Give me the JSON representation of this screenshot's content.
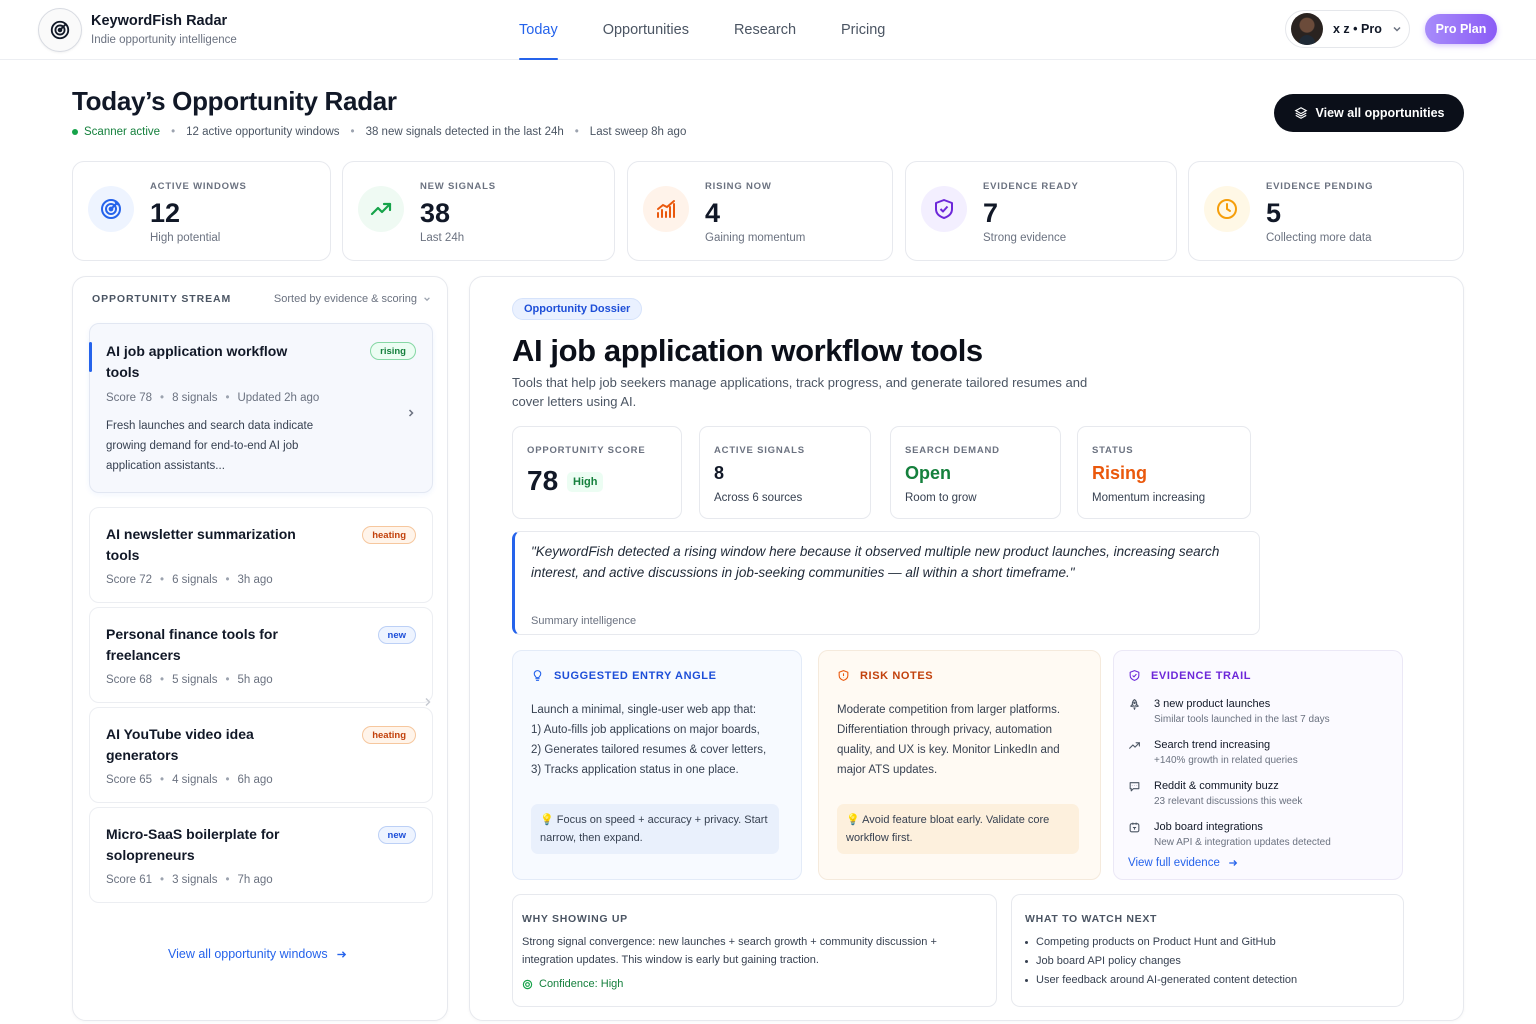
{
  "brand": {
    "name": "KeywordFish Radar",
    "tagline": "Indie opportunity intelligence"
  },
  "nav": {
    "items": [
      "Today",
      "Opportunities",
      "Research",
      "Pricing"
    ],
    "active": "Today"
  },
  "user": {
    "label": "x z • Pro",
    "plan_button": "Pro Plan"
  },
  "page": {
    "title": "Today’s Opportunity Radar",
    "scanner_status": "Scanner active",
    "windows_text": "12 active opportunity windows",
    "signals_text": "38 new signals detected in the last 24h",
    "sweep_text": "Last sweep 8h ago",
    "view_all_button": "View all opportunities"
  },
  "stats": [
    {
      "label": "ACTIVE WINDOWS",
      "value": "12",
      "sub": "High potential",
      "icon": "target-icon",
      "color": "#2563eb"
    },
    {
      "label": "NEW SIGNALS",
      "value": "38",
      "sub": "Last 24h",
      "icon": "trend-up-icon",
      "color": "#16a34a"
    },
    {
      "label": "RISING NOW",
      "value": "4",
      "sub": "Gaining momentum",
      "icon": "bar-chart-icon",
      "color": "#ea580c"
    },
    {
      "label": "EVIDENCE READY",
      "value": "7",
      "sub": "Strong evidence",
      "icon": "shield-check-icon",
      "color": "#6d28d9"
    },
    {
      "label": "EVIDENCE PENDING",
      "value": "5",
      "sub": "Collecting more data",
      "icon": "clock-icon",
      "color": "#f59e0b"
    }
  ],
  "stream": {
    "heading": "OPPORTUNITY STREAM",
    "sort_label": "Sorted by evidence & scoring",
    "footer_link": "View all opportunity windows",
    "items": [
      {
        "title": "AI job application workflow tools",
        "score": "Score 78",
        "signals": "8 signals",
        "time": "Updated 2h ago",
        "badge": "rising",
        "desc": "Fresh launches and search data indicate growing demand for end-to-end AI job application assistants..."
      },
      {
        "title": "AI newsletter summarization tools",
        "score": "Score 72",
        "signals": "6 signals",
        "time": "3h ago",
        "badge": "heating"
      },
      {
        "title": "Personal finance tools for freelancers",
        "score": "Score 68",
        "signals": "5 signals",
        "time": "5h ago",
        "badge": "new"
      },
      {
        "title": "AI YouTube video idea generators",
        "score": "Score 65",
        "signals": "4 signals",
        "time": "6h ago",
        "badge": "heating"
      },
      {
        "title": "Micro-SaaS boilerplate for solopreneurs",
        "score": "Score 61",
        "signals": "3 signals",
        "time": "7h ago",
        "badge": "new"
      }
    ]
  },
  "dossier": {
    "chip": "Opportunity Dossier",
    "title": "AI job application workflow tools",
    "description": "Tools that help job seekers manage applications, track progress, and generate tailored resumes and cover letters using AI.",
    "metrics": {
      "score": {
        "label": "OPPORTUNITY SCORE",
        "value": "78",
        "level": "High"
      },
      "signals": {
        "label": "ACTIVE SIGNALS",
        "value": "8",
        "sub": "Across 6 sources"
      },
      "demand": {
        "label": "SEARCH DEMAND",
        "value": "Open",
        "sub": "Room to grow",
        "color": "#15803d"
      },
      "status": {
        "label": "STATUS",
        "value": "Rising",
        "sub": "Momentum increasing",
        "color": "#ea580c"
      }
    },
    "quote": "\"KeywordFish detected a rising window here because it observed multiple new product launches, increasing search interest, and active discussions in job-seeking communities — all within a short timeframe.\"",
    "quote_source": "Summary intelligence",
    "entry": {
      "heading": "SUGGESTED ENTRY ANGLE",
      "lines": [
        "Launch a minimal, single-user web app that:",
        "1) Auto-fills job applications on major boards,",
        "2) Generates tailored resumes & cover letters,",
        "3) Tracks application status in one place."
      ],
      "tip": "Focus on speed + accuracy + privacy. Start narrow, then expand."
    },
    "risk": {
      "heading": "RISK NOTES",
      "body": "Moderate competition from larger platforms. Differentiation through privacy, automation quality, and UX is key. Monitor LinkedIn and major ATS updates.",
      "tip": "Avoid feature bloat early. Validate core workflow first."
    },
    "evidence": {
      "heading": "EVIDENCE TRAIL",
      "items": [
        {
          "title": "3 new product launches",
          "sub": "Similar tools launched in the last 7 days",
          "icon": "rocket-icon"
        },
        {
          "title": "Search trend increasing",
          "sub": "+140% growth in related queries",
          "icon": "trend-icon"
        },
        {
          "title": "Reddit & community buzz",
          "sub": "23 relevant discussions this week",
          "icon": "chat-icon"
        },
        {
          "title": "Job board integrations",
          "sub": "New API & integration updates detected",
          "icon": "plug-icon"
        }
      ],
      "link": "View full evidence"
    },
    "why": {
      "heading": "WHY SHOWING UP",
      "body": "Strong signal convergence: new launches + search growth + community discussion + integration updates. This window is early but gaining traction.",
      "confidence": "Confidence: High"
    },
    "watch": {
      "heading": "WHAT TO WATCH NEXT",
      "items": [
        "Competing products on Product Hunt and GitHub",
        "Job board API policy changes",
        "User feedback around AI-generated content detection"
      ]
    }
  }
}
